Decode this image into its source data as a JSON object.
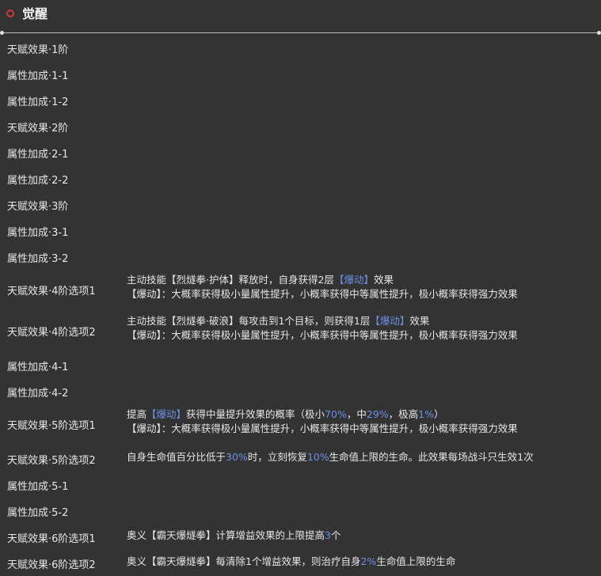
{
  "header": {
    "title": "觉醒"
  },
  "rows": [
    {
      "label": "天赋效果·1阶",
      "lines": []
    },
    {
      "label": "属性加成·1-1",
      "lines": []
    },
    {
      "label": "属性加成·1-2",
      "lines": []
    },
    {
      "label": "天赋效果·2阶",
      "lines": []
    },
    {
      "label": "属性加成·2-1",
      "lines": []
    },
    {
      "label": "属性加成·2-2",
      "lines": []
    },
    {
      "label": "天赋效果·3阶",
      "lines": []
    },
    {
      "label": "属性加成·3-1",
      "lines": []
    },
    {
      "label": "属性加成·3-2",
      "lines": []
    },
    {
      "label": "天赋效果·4阶选项1",
      "lines": [
        [
          {
            "t": "主动技能【烈燧拳·护体】释放时，自身获得2层"
          },
          {
            "t": "【爆动】",
            "hl": true
          },
          {
            "t": "效果"
          }
        ],
        [
          {
            "t": "【爆动】：大概率获得极小量属性提升，小概率获得中等属性提升，极小概率获得强力效果"
          }
        ]
      ]
    },
    {
      "label": "天赋效果·4阶选项2",
      "lines": [
        [
          {
            "t": "主动技能【烈燧拳·破浪】每攻击到1个目标，则获得1层"
          },
          {
            "t": "【爆动】",
            "hl": true
          },
          {
            "t": "效果"
          }
        ],
        [
          {
            "t": "【爆动】：大概率获得极小量属性提升，小概率获得中等属性提升，极小概率获得强力效果"
          }
        ]
      ]
    },
    {
      "label": "属性加成·4-1",
      "lines": []
    },
    {
      "label": "属性加成·4-2",
      "lines": []
    },
    {
      "label": "天赋效果·5阶选项1",
      "lines": [
        [
          {
            "t": "提高"
          },
          {
            "t": "【爆动】",
            "hl": true
          },
          {
            "t": "获得中量提升效果的概率（极小"
          },
          {
            "t": "70%",
            "hl": true
          },
          {
            "t": "，中"
          },
          {
            "t": "29%",
            "hl": true
          },
          {
            "t": "，极高"
          },
          {
            "t": "1%",
            "hl": true
          },
          {
            "t": "）"
          }
        ],
        [
          {
            "t": "【爆动】：大概率获得极小量属性提升，小概率获得中等属性提升，极小概率获得强力效果"
          }
        ]
      ]
    },
    {
      "label": "天赋效果·5阶选项2",
      "lines": [
        [
          {
            "t": "自身生命值百分比低于"
          },
          {
            "t": "30%",
            "hl": true
          },
          {
            "t": "时，立刻恢复"
          },
          {
            "t": "10%",
            "hl": true
          },
          {
            "t": "生命值上限的生命。此效果每场战斗只生效1次"
          }
        ]
      ]
    },
    {
      "label": "属性加成·5-1",
      "lines": []
    },
    {
      "label": "属性加成·5-2",
      "lines": []
    },
    {
      "label": "天赋效果·6阶选项1",
      "lines": [
        [
          {
            "t": "奥义【霸天爆燧拳】计算增益效果的上限提高"
          },
          {
            "t": "3",
            "hl": true
          },
          {
            "t": "个"
          }
        ]
      ]
    },
    {
      "label": "天赋效果·6阶选项2",
      "lines": [
        [
          {
            "t": "奥义【霸天爆燧拳】每清除1个增益效果，则治疗自身"
          },
          {
            "t": "2%",
            "hl": true
          },
          {
            "t": "生命值上限的生命"
          }
        ]
      ]
    }
  ]
}
